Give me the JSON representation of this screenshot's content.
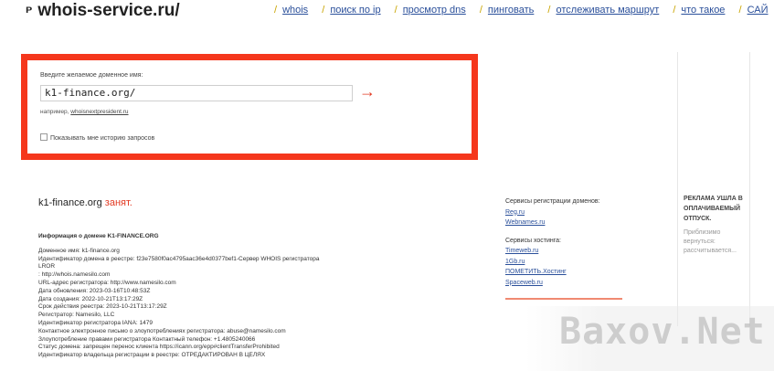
{
  "header": {
    "logo": "whois-service.ru/",
    "logo_mark": "ᴘ",
    "nav": [
      {
        "label": "whois",
        "active": true
      },
      {
        "label": "поиск по ip"
      },
      {
        "label": "просмотр dns"
      },
      {
        "label": "пинговать"
      },
      {
        "label": "отслеживать маршрут"
      },
      {
        "label": "что такое"
      },
      {
        "label": "САЙ"
      }
    ]
  },
  "search": {
    "label": "Введите желаемое доменное имя:",
    "value": "k1-finance.org/",
    "arrow": "→",
    "example_prefix": "например,",
    "example_link": "whoisnextpresident.ru",
    "history_label": "Показывать мне историю запросов"
  },
  "result": {
    "domain": "k1-finance.org",
    "status": "занят."
  },
  "whois": {
    "title": "Информация о домене K1-FINANCE.ORG",
    "lines": [
      "Доменное имя: k1-finance.org",
      "Идентификатор домена в реестре: f23e7580f0ac4795aac36e4d0377bef1-Сервер WHOIS регистратора",
      "LROR",
      ": http://whois.namesilo.com",
      "URL-адрес регистратора: http://www.namesilo.com",
      "Дата обновления: 2023-03-16T10:48:53Z",
      "Дата создания: 2022-10-21T13:17:29Z",
      "Срок действия реестра: 2023-10-21T13:17:29Z",
      "Регистратор: Namesilo, LLC",
      "Идентификатор регистратора IANA: 1479",
      "Контактное электронное письмо о злоупотреблениях регистратора: abuse@namesilo.com",
      "Злоупотребление правами регистратора Контактный телефон: +1.4805240066",
      "Статус домена: запрещен перенос клиента https://icann.org/epp#clientTransferProhibited",
      "Идентификатор владельца регистрации в реестре: ОТРЕДАКТИРОВАН В ЦЕЛЯХ"
    ]
  },
  "sidebar": {
    "registrars_title": "Сервисы регистрации доменов:",
    "registrars": [
      "Reg.ru",
      "Webnames.ru"
    ],
    "hosting_title": "Сервисы хостинга:",
    "hosting": [
      "Timeweb.ru",
      "1Gb.ru",
      "ПОМЕТИТЬ.Хостинг",
      "Spaceweb.ru"
    ]
  },
  "ad": {
    "title": "РЕКЛАМА УШЛА В ОПЛАЧИВАЕМЫЙ ОТПУСК.",
    "subtitle": "Приблизимо вернуться: рассчитывается..."
  },
  "watermark": {
    "text": "Baxov.Net"
  }
}
